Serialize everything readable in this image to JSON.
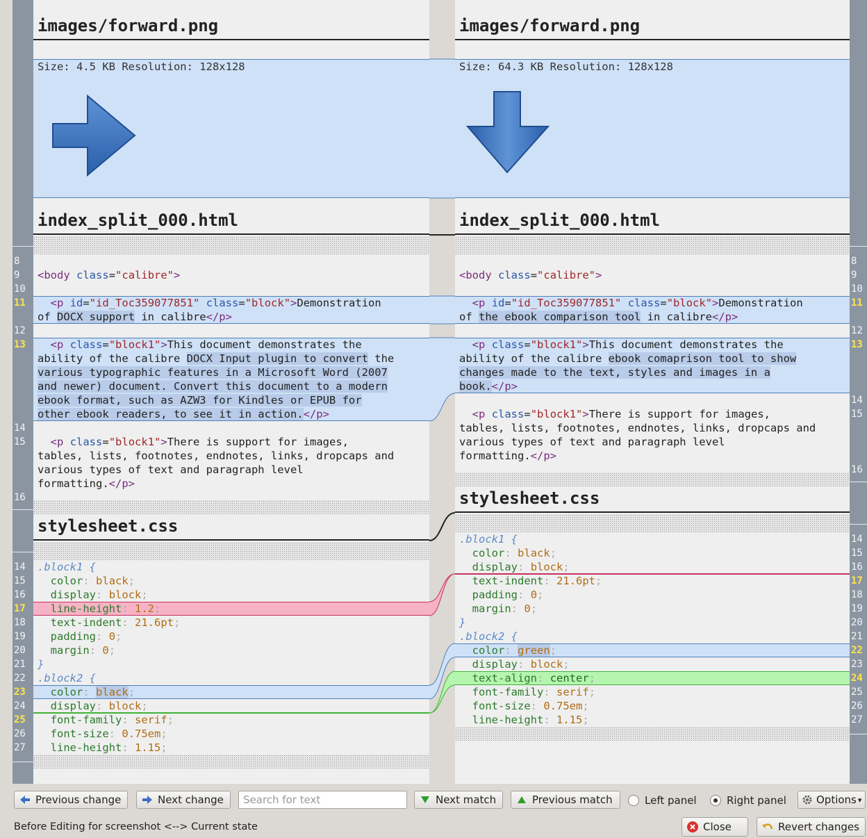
{
  "left": {
    "file1": "images/forward.png",
    "info": "Size: 4.5 KB Resolution: 128x128",
    "file2": "index_split_000.html",
    "file3": "stylesheet.css"
  },
  "right": {
    "file1": "images/forward.png",
    "info": "Size: 64.3 KB Resolution: 128x128",
    "file2": "index_split_000.html",
    "file3": "stylesheet.css"
  },
  "toolbar": {
    "prev_change": "Previous change",
    "next_change": "Next change",
    "search_placeholder": "Search for text",
    "next_match": "Next match",
    "prev_match": "Previous match",
    "left_panel": "Left panel",
    "right_panel": "Right panel",
    "options": "Options",
    "close": "Close",
    "revert": "Revert changes",
    "selected_panel": "Right panel"
  },
  "status": "Before Editing for screenshot <--> Current state",
  "icons": {
    "left_image": "right-arrow-icon",
    "right_image": "down-arrow-icon"
  },
  "colors": {
    "changed": "#cfe1f7",
    "removed": "#f6b3c5",
    "added": "#b6f5b0"
  }
}
